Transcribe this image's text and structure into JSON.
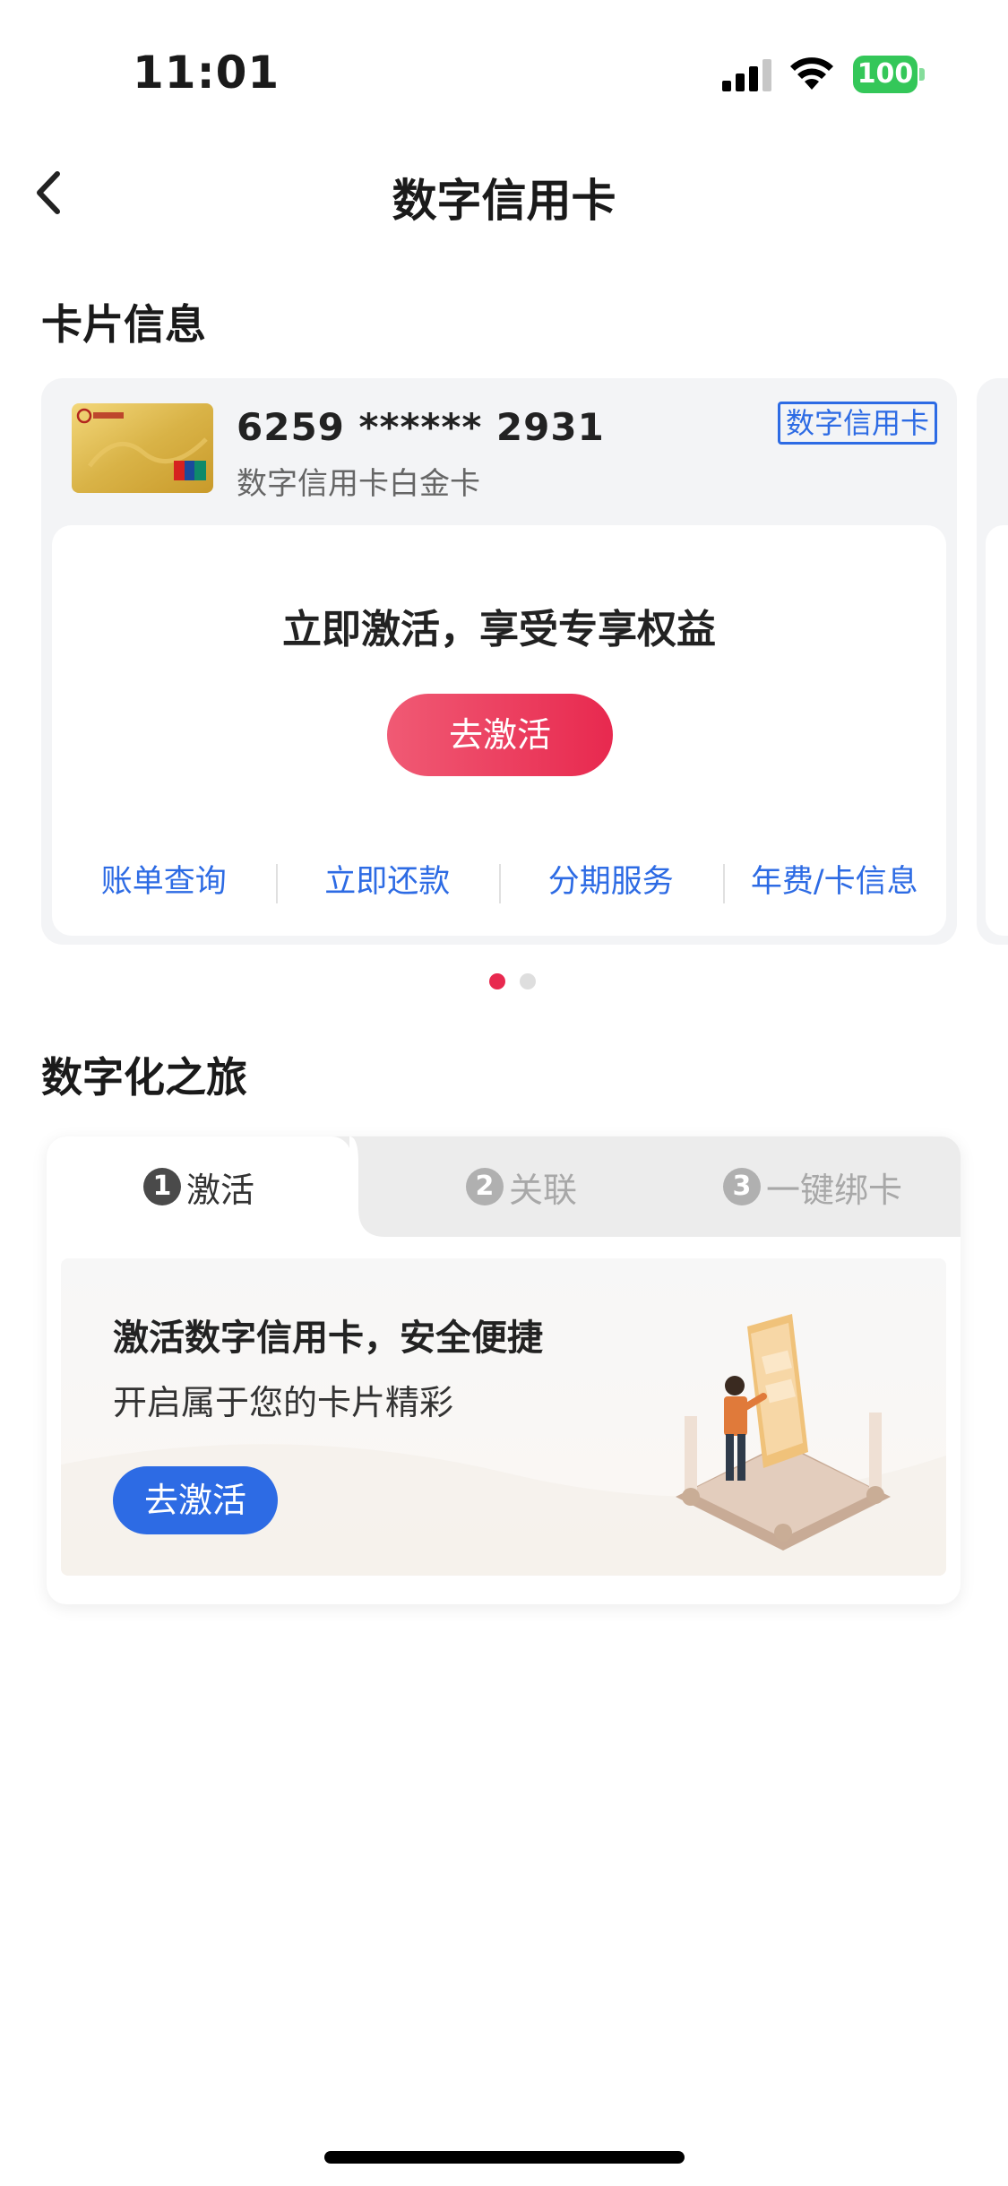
{
  "status_bar": {
    "time": "11:01",
    "battery": "100"
  },
  "nav": {
    "title": "数字信用卡"
  },
  "card_section": {
    "title": "卡片信息"
  },
  "card": {
    "number": "6259 ****** 2931",
    "type": "数字信用卡白金卡",
    "tag": "数字信用卡",
    "activate_prompt": "立即激活，享受专享权益",
    "activate_button": "去激活",
    "actions": [
      "账单查询",
      "立即还款",
      "分期服务",
      "年费/卡信息"
    ]
  },
  "journey_section": {
    "title": "数字化之旅"
  },
  "journey": {
    "tabs": [
      {
        "num": "1",
        "label": "激活"
      },
      {
        "num": "2",
        "label": "关联"
      },
      {
        "num": "3",
        "label": "一键绑卡"
      }
    ],
    "heading": "激活数字信用卡，安全便捷",
    "subtext": "开启属于您的卡片精彩",
    "button": "去激活"
  },
  "colors": {
    "accent_red": "#e8294f",
    "accent_blue": "#2d6be4",
    "battery_green": "#34c759"
  }
}
